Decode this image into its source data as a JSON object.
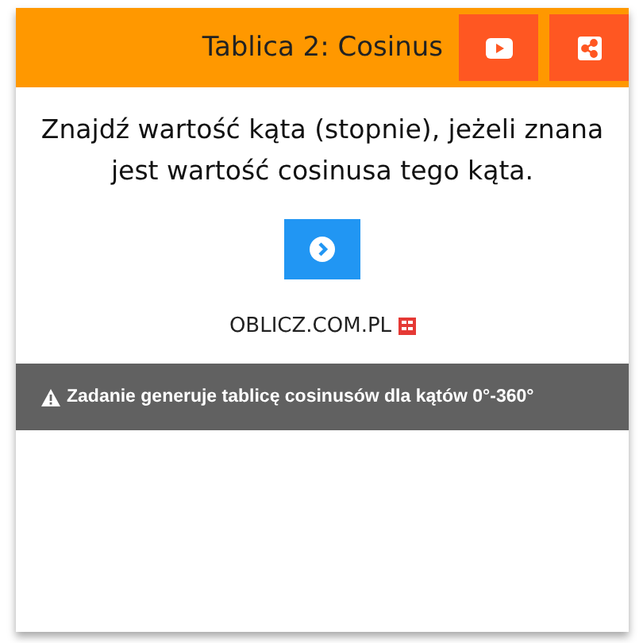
{
  "header": {
    "title": "Tablica 2: Cosinus"
  },
  "question": "Znajdź wartość kąta (stopnie), jeżeli znana jest wartość cosinusa tego kąta.",
  "brand": "OBLICZ.COM.PL",
  "note": "Zadanie generuje tablicę cosinusów dla kątów 0°-360°"
}
